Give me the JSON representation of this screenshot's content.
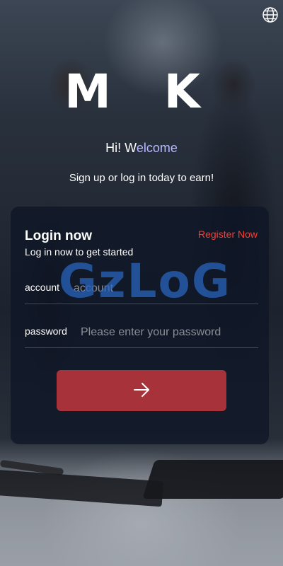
{
  "header": {
    "language_icon": "globe-icon",
    "logo_text": "M K"
  },
  "welcome": {
    "greeting_part1": "Hi! W",
    "greeting_part2": "elcome",
    "tagline": "Sign up or log in today to earn!"
  },
  "login": {
    "title": "Login now",
    "subtitle": "Log in now to get started",
    "register_link": "Register Now",
    "account_label": "account",
    "account_placeholder": "account",
    "password_label": "password",
    "password_placeholder": "Please enter your password",
    "submit_icon": "arrow-right-icon"
  },
  "watermark": {
    "text": "GzLoG"
  },
  "colors": {
    "accent_red": "#a8323a",
    "register_red": "#ff3b30",
    "greeting_highlight": "#b3b9ff",
    "watermark_blue": "#2864be"
  }
}
